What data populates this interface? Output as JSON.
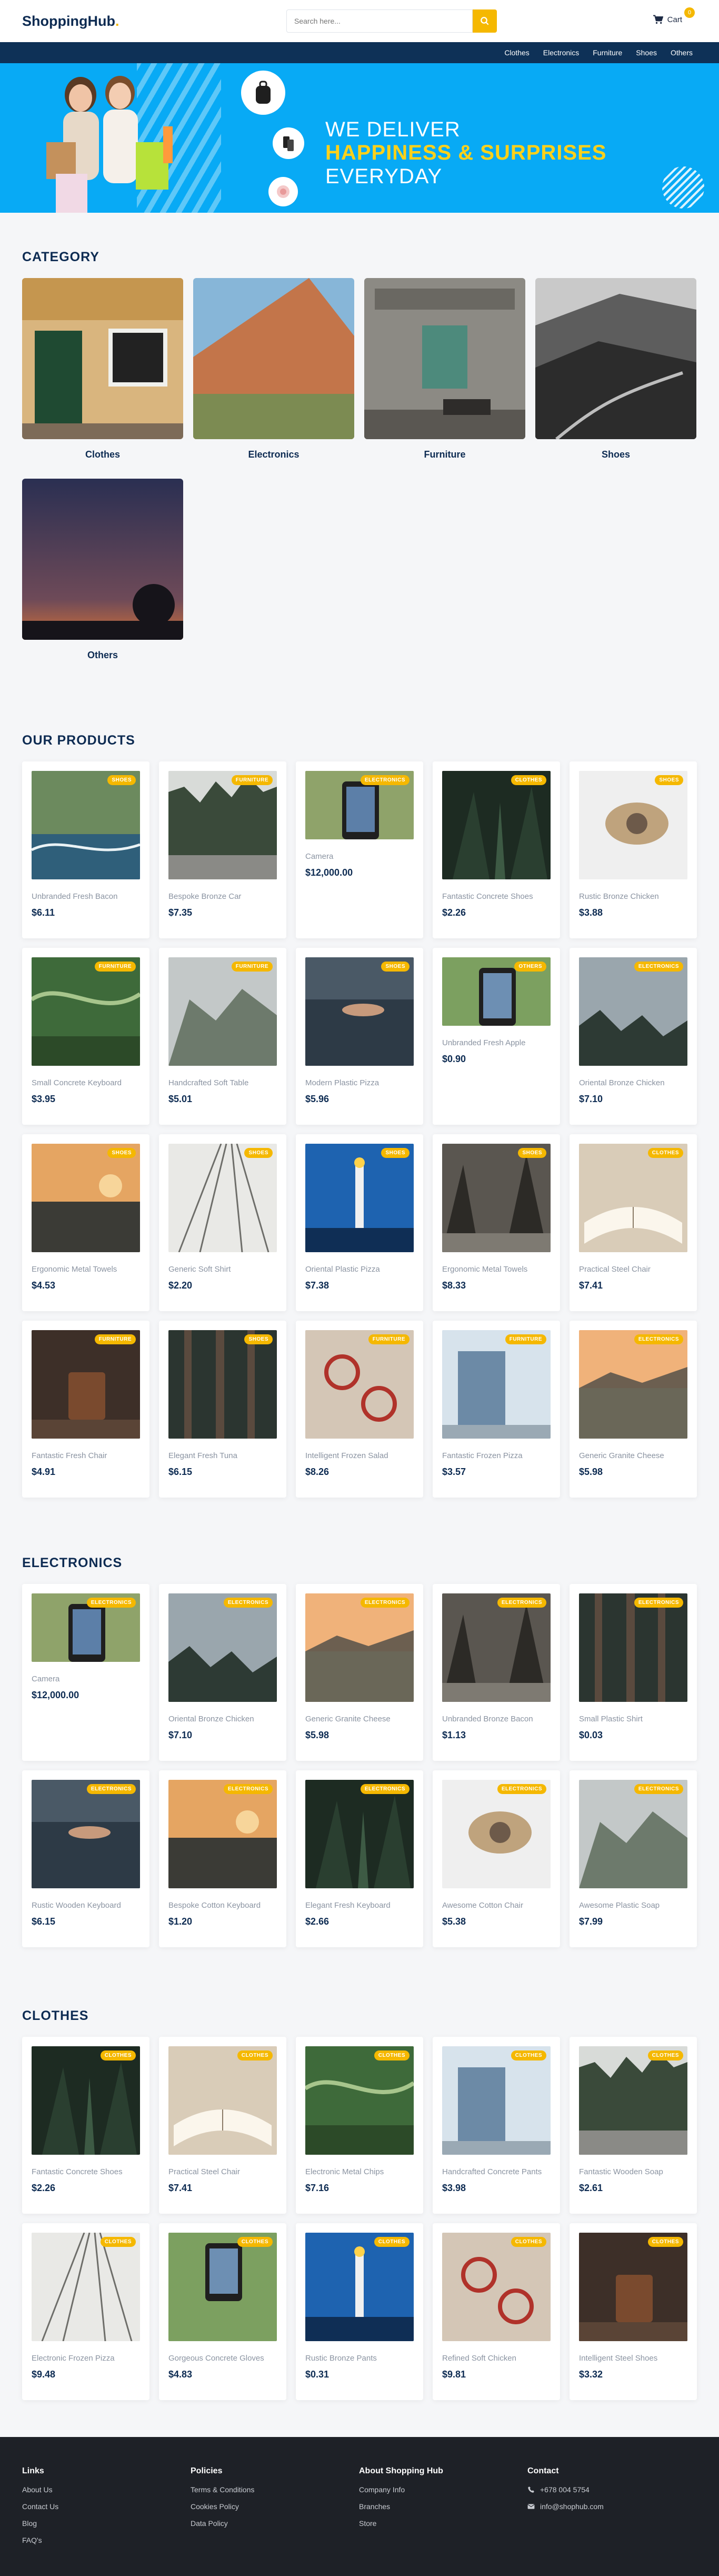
{
  "header": {
    "logo_main": "ShoppingHub",
    "logo_dot": ".",
    "search_placeholder": "Search here...",
    "cart_label": "Cart",
    "cart_count": "0",
    "icons": {
      "search": "search-icon",
      "cart": "cart-icon"
    }
  },
  "nav": [
    "Clothes",
    "Electronics",
    "Furniture",
    "Shoes",
    "Others"
  ],
  "hero": {
    "line1": "WE DELIVER",
    "line2_accent": "HAPPINESS & SURPRISES",
    "line2_rest": " EVERYDAY"
  },
  "category": {
    "title": "CATEGORY",
    "items": [
      "Clothes",
      "Electronics",
      "Furniture",
      "Shoes",
      "Others"
    ]
  },
  "our_products": {
    "title": "OUR PRODUCTS",
    "items": [
      {
        "name": "Unbranded Fresh Bacon",
        "price": "$6.11",
        "tag": "SHOES"
      },
      {
        "name": "Bespoke Bronze Car",
        "price": "$7.35",
        "tag": "FURNITURE"
      },
      {
        "name": "Camera",
        "price": "$12,000.00",
        "tag": "ELECTRONICS"
      },
      {
        "name": "Fantastic Concrete Shoes",
        "price": "$2.26",
        "tag": "CLOTHES"
      },
      {
        "name": "Rustic Bronze Chicken",
        "price": "$3.88",
        "tag": "SHOES"
      },
      {
        "name": "Small Concrete Keyboard",
        "price": "$3.95",
        "tag": "FURNITURE"
      },
      {
        "name": "Handcrafted Soft Table",
        "price": "$5.01",
        "tag": "FURNITURE"
      },
      {
        "name": "Modern Plastic Pizza",
        "price": "$5.96",
        "tag": "SHOES"
      },
      {
        "name": "Unbranded Fresh Apple",
        "price": "$0.90",
        "tag": "OTHERS"
      },
      {
        "name": "Oriental Bronze Chicken",
        "price": "$7.10",
        "tag": "ELECTRONICS"
      },
      {
        "name": "Ergonomic Metal Towels",
        "price": "$4.53",
        "tag": "SHOES"
      },
      {
        "name": "Generic Soft Shirt",
        "price": "$2.20",
        "tag": "SHOES"
      },
      {
        "name": "Oriental Plastic Pizza",
        "price": "$7.38",
        "tag": "SHOES"
      },
      {
        "name": "Ergonomic Metal Towels",
        "price": "$8.33",
        "tag": "SHOES"
      },
      {
        "name": "Practical Steel Chair",
        "price": "$7.41",
        "tag": "CLOTHES"
      },
      {
        "name": "Fantastic Fresh Chair",
        "price": "$4.91",
        "tag": "FURNITURE"
      },
      {
        "name": "Elegant Fresh Tuna",
        "price": "$6.15",
        "tag": "SHOES"
      },
      {
        "name": "Intelligent Frozen Salad",
        "price": "$8.26",
        "tag": "FURNITURE"
      },
      {
        "name": "Fantastic Frozen Pizza",
        "price": "$3.57",
        "tag": "FURNITURE"
      },
      {
        "name": "Generic Granite Cheese",
        "price": "$5.98",
        "tag": "ELECTRONICS"
      }
    ]
  },
  "electronics": {
    "title": "ELECTRONICS",
    "items": [
      {
        "name": "Camera",
        "price": "$12,000.00",
        "tag": "ELECTRONICS"
      },
      {
        "name": "Oriental Bronze Chicken",
        "price": "$7.10",
        "tag": "ELECTRONICS"
      },
      {
        "name": "Generic Granite Cheese",
        "price": "$5.98",
        "tag": "ELECTRONICS"
      },
      {
        "name": "Unbranded Bronze Bacon",
        "price": "$1.13",
        "tag": "ELECTRONICS"
      },
      {
        "name": "Small Plastic Shirt",
        "price": "$0.03",
        "tag": "ELECTRONICS"
      },
      {
        "name": "Rustic Wooden Keyboard",
        "price": "$6.15",
        "tag": "ELECTRONICS"
      },
      {
        "name": "Bespoke Cotton Keyboard",
        "price": "$1.20",
        "tag": "ELECTRONICS"
      },
      {
        "name": "Elegant Fresh Keyboard",
        "price": "$2.66",
        "tag": "ELECTRONICS"
      },
      {
        "name": "Awesome Cotton Chair",
        "price": "$5.38",
        "tag": "ELECTRONICS"
      },
      {
        "name": "Awesome Plastic Soap",
        "price": "$7.99",
        "tag": "ELECTRONICS"
      }
    ]
  },
  "clothes": {
    "title": "CLOTHES",
    "items": [
      {
        "name": "Fantastic Concrete Shoes",
        "price": "$2.26",
        "tag": "CLOTHES"
      },
      {
        "name": "Practical Steel Chair",
        "price": "$7.41",
        "tag": "CLOTHES"
      },
      {
        "name": "Electronic Metal Chips",
        "price": "$7.16",
        "tag": "CLOTHES"
      },
      {
        "name": "Handcrafted Concrete Pants",
        "price": "$3.98",
        "tag": "CLOTHES"
      },
      {
        "name": "Fantastic Wooden Soap",
        "price": "$2.61",
        "tag": "CLOTHES"
      },
      {
        "name": "Electronic Frozen Pizza",
        "price": "$9.48",
        "tag": "CLOTHES"
      },
      {
        "name": "Gorgeous Concrete Gloves",
        "price": "$4.83",
        "tag": "CLOTHES"
      },
      {
        "name": "Rustic Bronze Pants",
        "price": "$0.31",
        "tag": "CLOTHES"
      },
      {
        "name": "Refined Soft Chicken",
        "price": "$9.81",
        "tag": "CLOTHES"
      },
      {
        "name": "Intelligent Steel Shoes",
        "price": "$3.32",
        "tag": "CLOTHES"
      }
    ]
  },
  "footer": {
    "links": {
      "title": "Links",
      "items": [
        "About Us",
        "Contact Us",
        "Blog",
        "FAQ's"
      ]
    },
    "policies": {
      "title": "Policies",
      "items": [
        "Terms & Conditions",
        "Cookies Policy",
        "Data Policy"
      ]
    },
    "about": {
      "title": "About Shopping Hub",
      "items": [
        "Company Info",
        "Branches",
        "Store"
      ]
    },
    "contact": {
      "title": "Contact",
      "phone": "+678 004 5754",
      "email": "info@shophub.com"
    }
  },
  "colors": {
    "accent": "#f5b800",
    "navy": "#0e3157",
    "hero_blue": "#08aaf5",
    "footer": "#1e2127"
  }
}
